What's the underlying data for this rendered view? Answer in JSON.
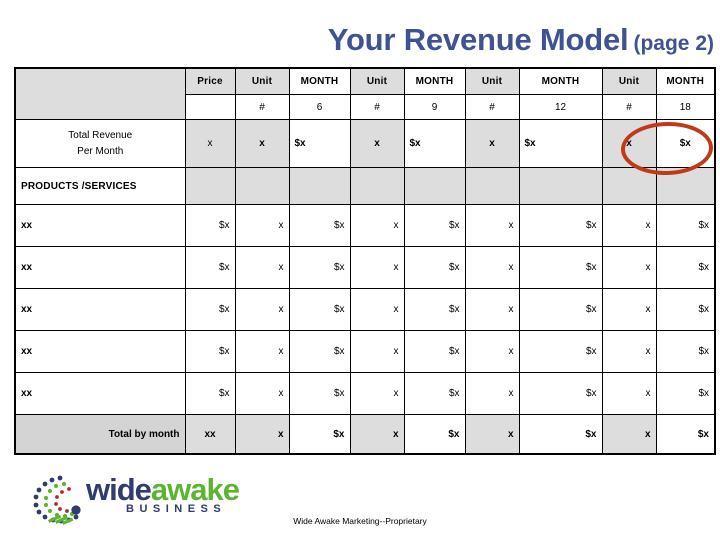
{
  "title": {
    "main": "Your Revenue Model",
    "page": "(page 2)",
    "color": "#3f5392"
  },
  "table": {
    "corner_label": "",
    "header_row_1": [
      "Price",
      "Unit",
      "MONTH",
      "Unit",
      "MONTH",
      "Unit",
      "MONTH",
      "Unit",
      "MONTH"
    ],
    "header_row_2": [
      "",
      "#",
      "6",
      "#",
      "9",
      "#",
      "12",
      "#",
      "18"
    ],
    "total_revenue_row": {
      "label_line1": "Total Revenue",
      "label_line2": "Per Month",
      "values": [
        "x",
        "x",
        "$x",
        "x",
        "$x",
        "x",
        "$x",
        "x",
        "$x"
      ]
    },
    "products_services_label": "PRODUCTS /SERVICES",
    "products_services_values": [
      "",
      "",
      "",
      "",
      "",
      "",
      "",
      "",
      ""
    ],
    "item_rows": [
      {
        "label": "xx",
        "values": [
          "$x",
          "x",
          "$x",
          "x",
          "$x",
          "x",
          "$x",
          "x",
          "$x"
        ]
      },
      {
        "label": "xx",
        "values": [
          "$x",
          "x",
          "$x",
          "x",
          "$x",
          "x",
          "$x",
          "x",
          "$x"
        ]
      },
      {
        "label": "xx",
        "values": [
          "$x",
          "x",
          "$x",
          "x",
          "$x",
          "x",
          "$x",
          "x",
          "$x"
        ]
      },
      {
        "label": "xx",
        "values": [
          "$x",
          "x",
          "$x",
          "x",
          "$x",
          "x",
          "$x",
          "x",
          "$x"
        ]
      },
      {
        "label": "xx",
        "values": [
          "$x",
          "x",
          "$x",
          "x",
          "$x",
          "x",
          "$x",
          "x",
          "$x"
        ]
      }
    ],
    "total_by_month_row": {
      "label": "Total by month",
      "values": [
        "xx",
        "x",
        "$x",
        "x",
        "$x",
        "x",
        "$x",
        "x",
        "$x"
      ]
    }
  },
  "annotation": {
    "name": "ellipse-highlight",
    "color": "#c0391b",
    "target": "last-month-total-revenue-cell"
  },
  "logo": {
    "word_1": "wide",
    "word_2": "awake",
    "tagline": "BUSINESS",
    "color_1": "#2e3c6e",
    "color_2": "#5cb531"
  },
  "footer": {
    "note": "Wide Awake Marketing--Proprietary"
  }
}
